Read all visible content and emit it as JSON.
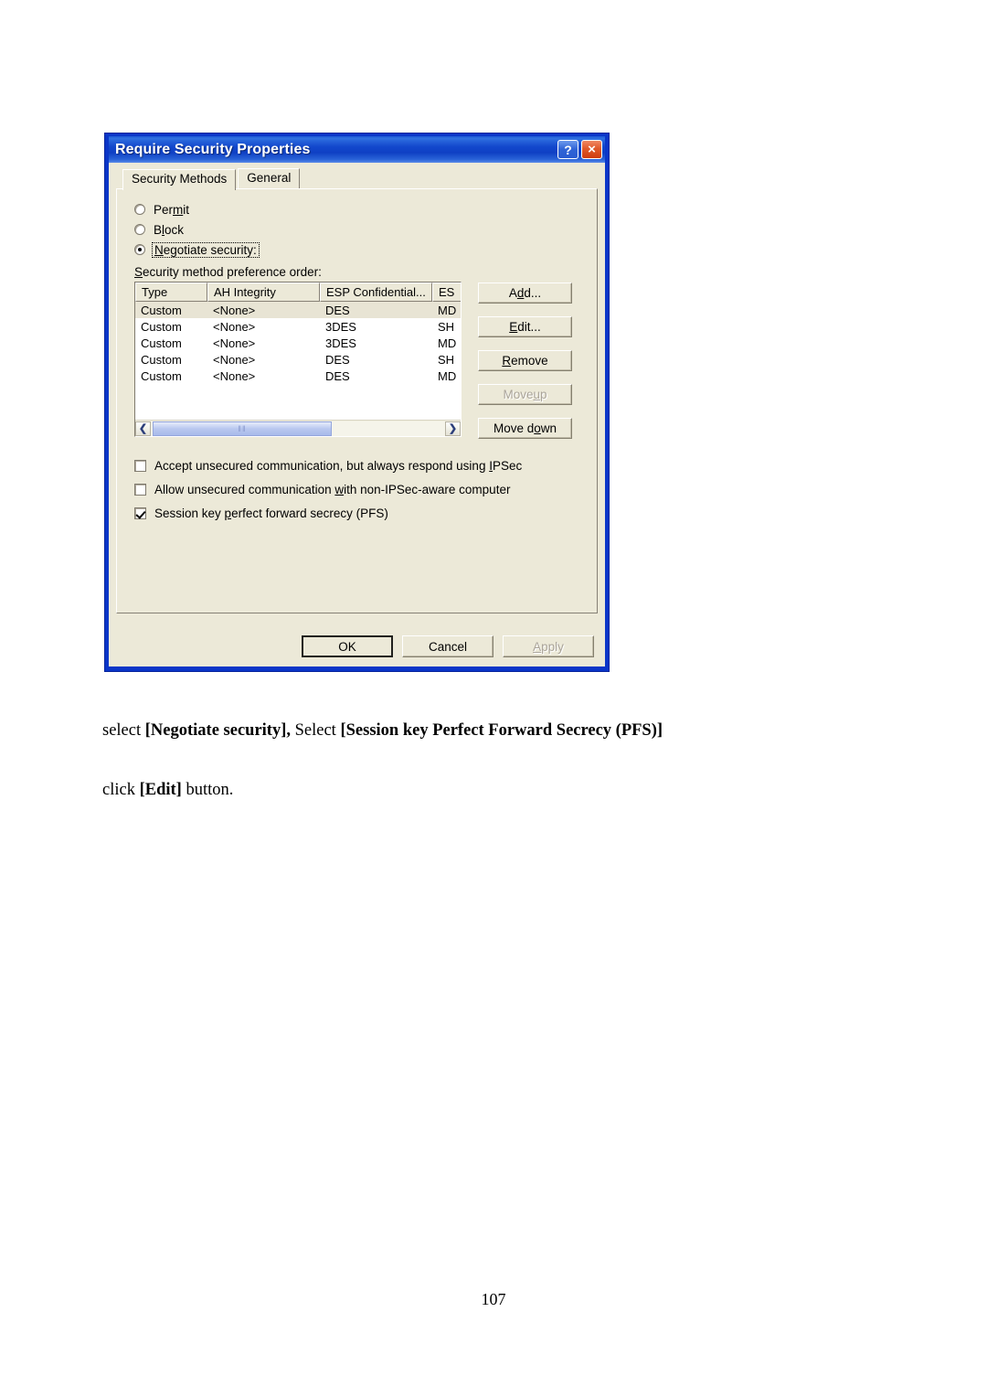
{
  "dialog": {
    "title": "Require Security Properties",
    "titlebar_buttons": [
      {
        "name": "help",
        "glyph": "?"
      },
      {
        "name": "close",
        "glyph": "×"
      }
    ],
    "tabs": [
      {
        "label": "Security Methods",
        "active": true
      },
      {
        "label": "General",
        "active": false
      }
    ],
    "radios": [
      {
        "label": "Permit",
        "accel": "m",
        "checked": false,
        "focused": false
      },
      {
        "label": "Block",
        "accel": "l",
        "checked": false,
        "focused": false
      },
      {
        "label": "Negotiate security:",
        "accel": "N",
        "checked": true,
        "focused": true
      }
    ],
    "list_label": "Security method preference order:",
    "list": {
      "columns": [
        "Type",
        "AH Integrity",
        "ESP Confidential...",
        "ES"
      ],
      "rows": [
        {
          "cells": [
            "Custom",
            "<None>",
            "DES",
            "MD"
          ],
          "selected": true
        },
        {
          "cells": [
            "Custom",
            "<None>",
            "3DES",
            "SH"
          ],
          "selected": false
        },
        {
          "cells": [
            "Custom",
            "<None>",
            "3DES",
            "MD"
          ],
          "selected": false
        },
        {
          "cells": [
            "Custom",
            "<None>",
            "DES",
            "SH"
          ],
          "selected": false
        },
        {
          "cells": [
            "Custom",
            "<None>",
            "DES",
            "MD"
          ],
          "selected": false
        }
      ],
      "scrollbar": {
        "left_arrow": "❮",
        "right_arrow": "❯",
        "grip": "‖‖"
      }
    },
    "side_buttons": [
      {
        "label": "Add...",
        "enabled": true
      },
      {
        "label": "Edit...",
        "enabled": true
      },
      {
        "label": "Remove",
        "enabled": true
      },
      {
        "label": "Move up",
        "enabled": false
      },
      {
        "label": "Move down",
        "enabled": true
      }
    ],
    "checkboxes": [
      {
        "label": "Accept unsecured communication, but always respond using IPSec",
        "checked": false
      },
      {
        "label": "Allow unsecured communication with non-IPSec-aware computer",
        "checked": false
      },
      {
        "label": "Session key perfect forward secrecy (PFS)",
        "checked": true
      }
    ],
    "footer_buttons": [
      {
        "label": "OK",
        "enabled": true,
        "default": true
      },
      {
        "label": "Cancel",
        "enabled": true,
        "default": false
      },
      {
        "label": "Apply",
        "enabled": false,
        "default": false
      }
    ]
  },
  "page": {
    "caption_line_1_a": "select ",
    "caption_line_1_b": "[Negotiate security],",
    "caption_line_1_c": " Select ",
    "caption_line_1_d": "[Session key Perfect Forward Secrecy (PFS)]",
    "caption_line_2_a": "click ",
    "caption_line_2_b": "[Edit]",
    "caption_line_2_c": " button.",
    "page_number": "107"
  },
  "colors": {
    "titlebar_blue": "#0f40c4",
    "window_frame": "#0a36c8",
    "dialog_face": "#ece9d8",
    "list_background": "#ffffff",
    "row_selected": "#e8e4d4",
    "scroll_thumb": "#b9c8ef",
    "close_button": "#cf3c10",
    "disabled_text": "#aaa499"
  }
}
